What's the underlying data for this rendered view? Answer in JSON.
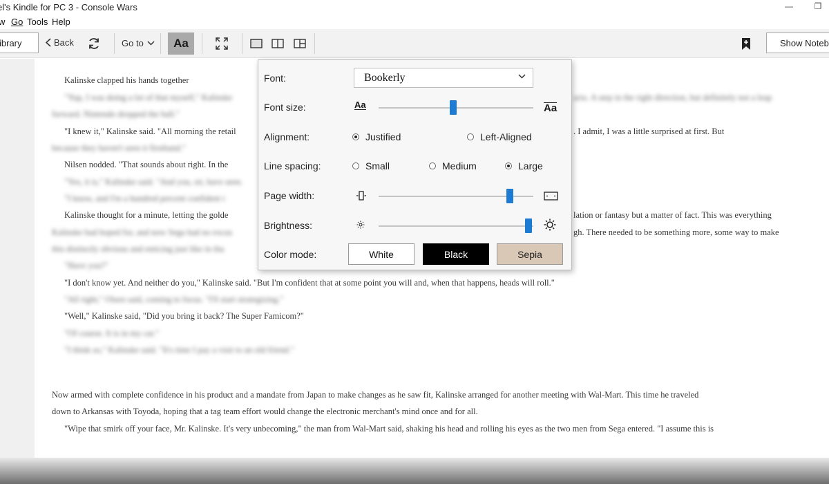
{
  "window": {
    "title": "el's Kindle for PC 3 - Console Wars",
    "minimize_glyph": "—",
    "restore_glyph": "❐"
  },
  "menu": [
    "w",
    "Go",
    "Tools",
    "Help"
  ],
  "toolbar": {
    "library": "ibrary",
    "back": "Back",
    "goto": "Go to",
    "aa": "Aa",
    "show_notebook": "Show Notebo",
    "icons": [
      "chevron-left-icon",
      "refresh-icon",
      "chevron-down-icon",
      "fullscreen-icon",
      "single-column-icon",
      "two-column-icon",
      "multi-column-icon",
      "bookmark-add-icon"
    ]
  },
  "settings": {
    "font_label": "Font:",
    "font_value": "Bookerly",
    "font_size_label": "Font size:",
    "font_size_small_icon": "Aa",
    "font_size_large_icon": "Aa",
    "font_size_level": 0.48,
    "alignment_label": "Alignment:",
    "alignment_options": [
      "Justified",
      "Left-Aligned"
    ],
    "alignment_selected": "Justified",
    "line_spacing_label": "Line spacing:",
    "line_spacing_options": [
      "Small",
      "Medium",
      "Large"
    ],
    "line_spacing_selected": "Large",
    "page_width_label": "Page width:",
    "page_width_level": 0.85,
    "brightness_label": "Brightness:",
    "brightness_level": 0.97,
    "color_mode_label": "Color mode:",
    "color_modes": [
      "White",
      "Black",
      "Sepia"
    ],
    "color_mode_colors": {
      "White": "#ffffff",
      "Black": "#000000",
      "Sepia": "#d9c8b6"
    },
    "accent_color": "#1e7bd4"
  },
  "book_text": {
    "l1": "Kalinske clapped his hands together",
    "l2a": "\"Yup, I was doing a lot of that myself,\" Kalinske",
    "l2b": "ario. A step in the right direction, but definitely not a leap",
    "l3": "forward. Nintendo dropped the ball.\"",
    "l4a": "\"I knew it,\" Kalinske said. \"All morning the retail",
    "l4b": ". I admit, I was a little surprised at first. But",
    "l5": "because they haven't seen it firsthand.\"",
    "l6": "Nilsen nodded. \"That sounds about right. In the",
    "l7": "\"Yes, it is,\" Kalinske said. \"And you, sir, have seen.",
    "l8": "\"I know, and I'm a hundred percent confident t",
    "l9a": "Kalinske thought for a minute, letting the golde",
    "l9b": "lation or fantasy but a matter of fact. This was everything",
    "l10a": "Kalinske had hoped for, and now Sega had no excus",
    "l10b": "gh. There needed to be something more, some way to make",
    "l11": "this distinctly obvious and enticing just like in tha",
    "l12": "\"Have you?\"",
    "l13": "\"I don't know yet. And neither do you,\" Kalinske said. \"But I'm confident that at some point you will and, when that happens, heads will roll.\"",
    "l14": "\"All right,\" Olsen said, coming to focus. \"I'll start strategizing.\"",
    "l15": "\"Well,\" Kalinske said, \"Did you bring it back? The Super Famicom?\"",
    "l16": "\"Of course. It is in my car.\"",
    "l17": "\"I think so,\" Kalinske said. \"It's time I pay a visit to an old friend.\"",
    "l18": "Now armed with complete confidence in his product and a mandate from Japan to make changes as he saw fit, Kalinske arranged for another meeting with Wal-Mart. This time he traveled",
    "l19": "down to Arkansas with Toyoda, hoping that a tag team effort would change the electronic merchant's mind once and for all.",
    "l20": "\"Wipe that smirk off your face, Mr. Kalinske. It's very unbecoming,\" the man from Wal-Mart said, shaking his head and rolling his eyes as the two men from Sega entered. \"I assume this is"
  }
}
